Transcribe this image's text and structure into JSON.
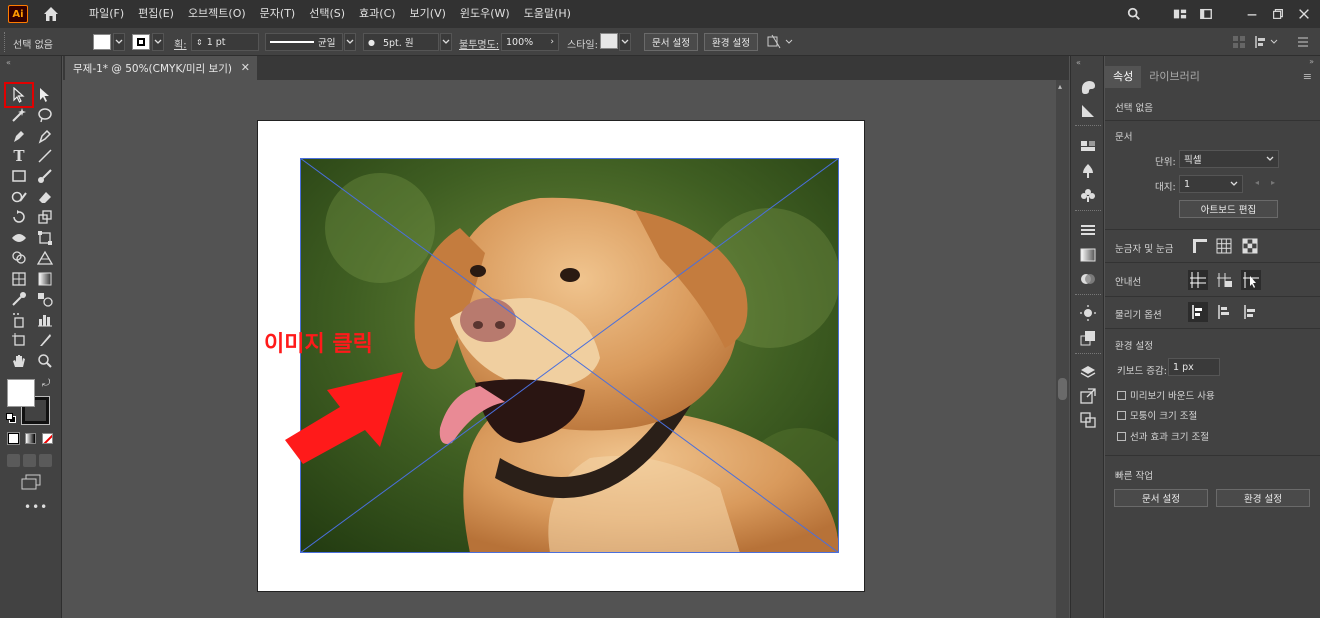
{
  "app": {
    "logo_text": "Ai"
  },
  "menu": [
    "파일(F)",
    "편집(E)",
    "오브젝트(O)",
    "문자(T)",
    "선택(S)",
    "효과(C)",
    "보기(V)",
    "윈도우(W)",
    "도움말(H)"
  ],
  "options": {
    "selection_label": "선택 없음",
    "stroke_label": "획:",
    "stroke_value": "1 pt",
    "stroke_style": "균일",
    "brush_value": "5pt. 원",
    "opacity_label": "불투명도:",
    "opacity_value": "100%",
    "style_label": "스타일:",
    "doc_setup_btn": "문서 설정",
    "prefs_btn": "환경 설정"
  },
  "document": {
    "tab_title": "무제-1* @ 50%(CMYK/미리 보기)"
  },
  "annotation": {
    "text": "이미지 클릭",
    "color": "#ff1a1a"
  },
  "colors": {
    "accent": "#ff1a1a",
    "selection": "#4a6fdc",
    "ui_dark": "#323232",
    "ui_panel": "#424242"
  },
  "panel": {
    "tabs": [
      "속성",
      "라이브러리"
    ],
    "selection_state": "선택 없음",
    "document_section": "문서",
    "units_label": "단위:",
    "units_value": "픽셀",
    "artboard_label": "대지:",
    "artboard_value": "1",
    "edit_artboard_btn": "아트보드 편집",
    "rulers_grid_label": "눈금자 및 눈금",
    "guides_label": "안내선",
    "snap_label": "물리기 옵션",
    "prefs_section": "환경 설정",
    "keyboard_inc_label": "키보드 증감:",
    "keyboard_inc_value": "1 px",
    "preview_bounds_label": "미리보기 바운드 사용",
    "scale_corners_label": "모퉁이 크기 조절",
    "scale_strokes_label": "선과 효과 크기 조절",
    "quick_actions": "빠른 작업",
    "qa_doc_setup": "문서 설정",
    "qa_prefs": "환경 설정"
  }
}
